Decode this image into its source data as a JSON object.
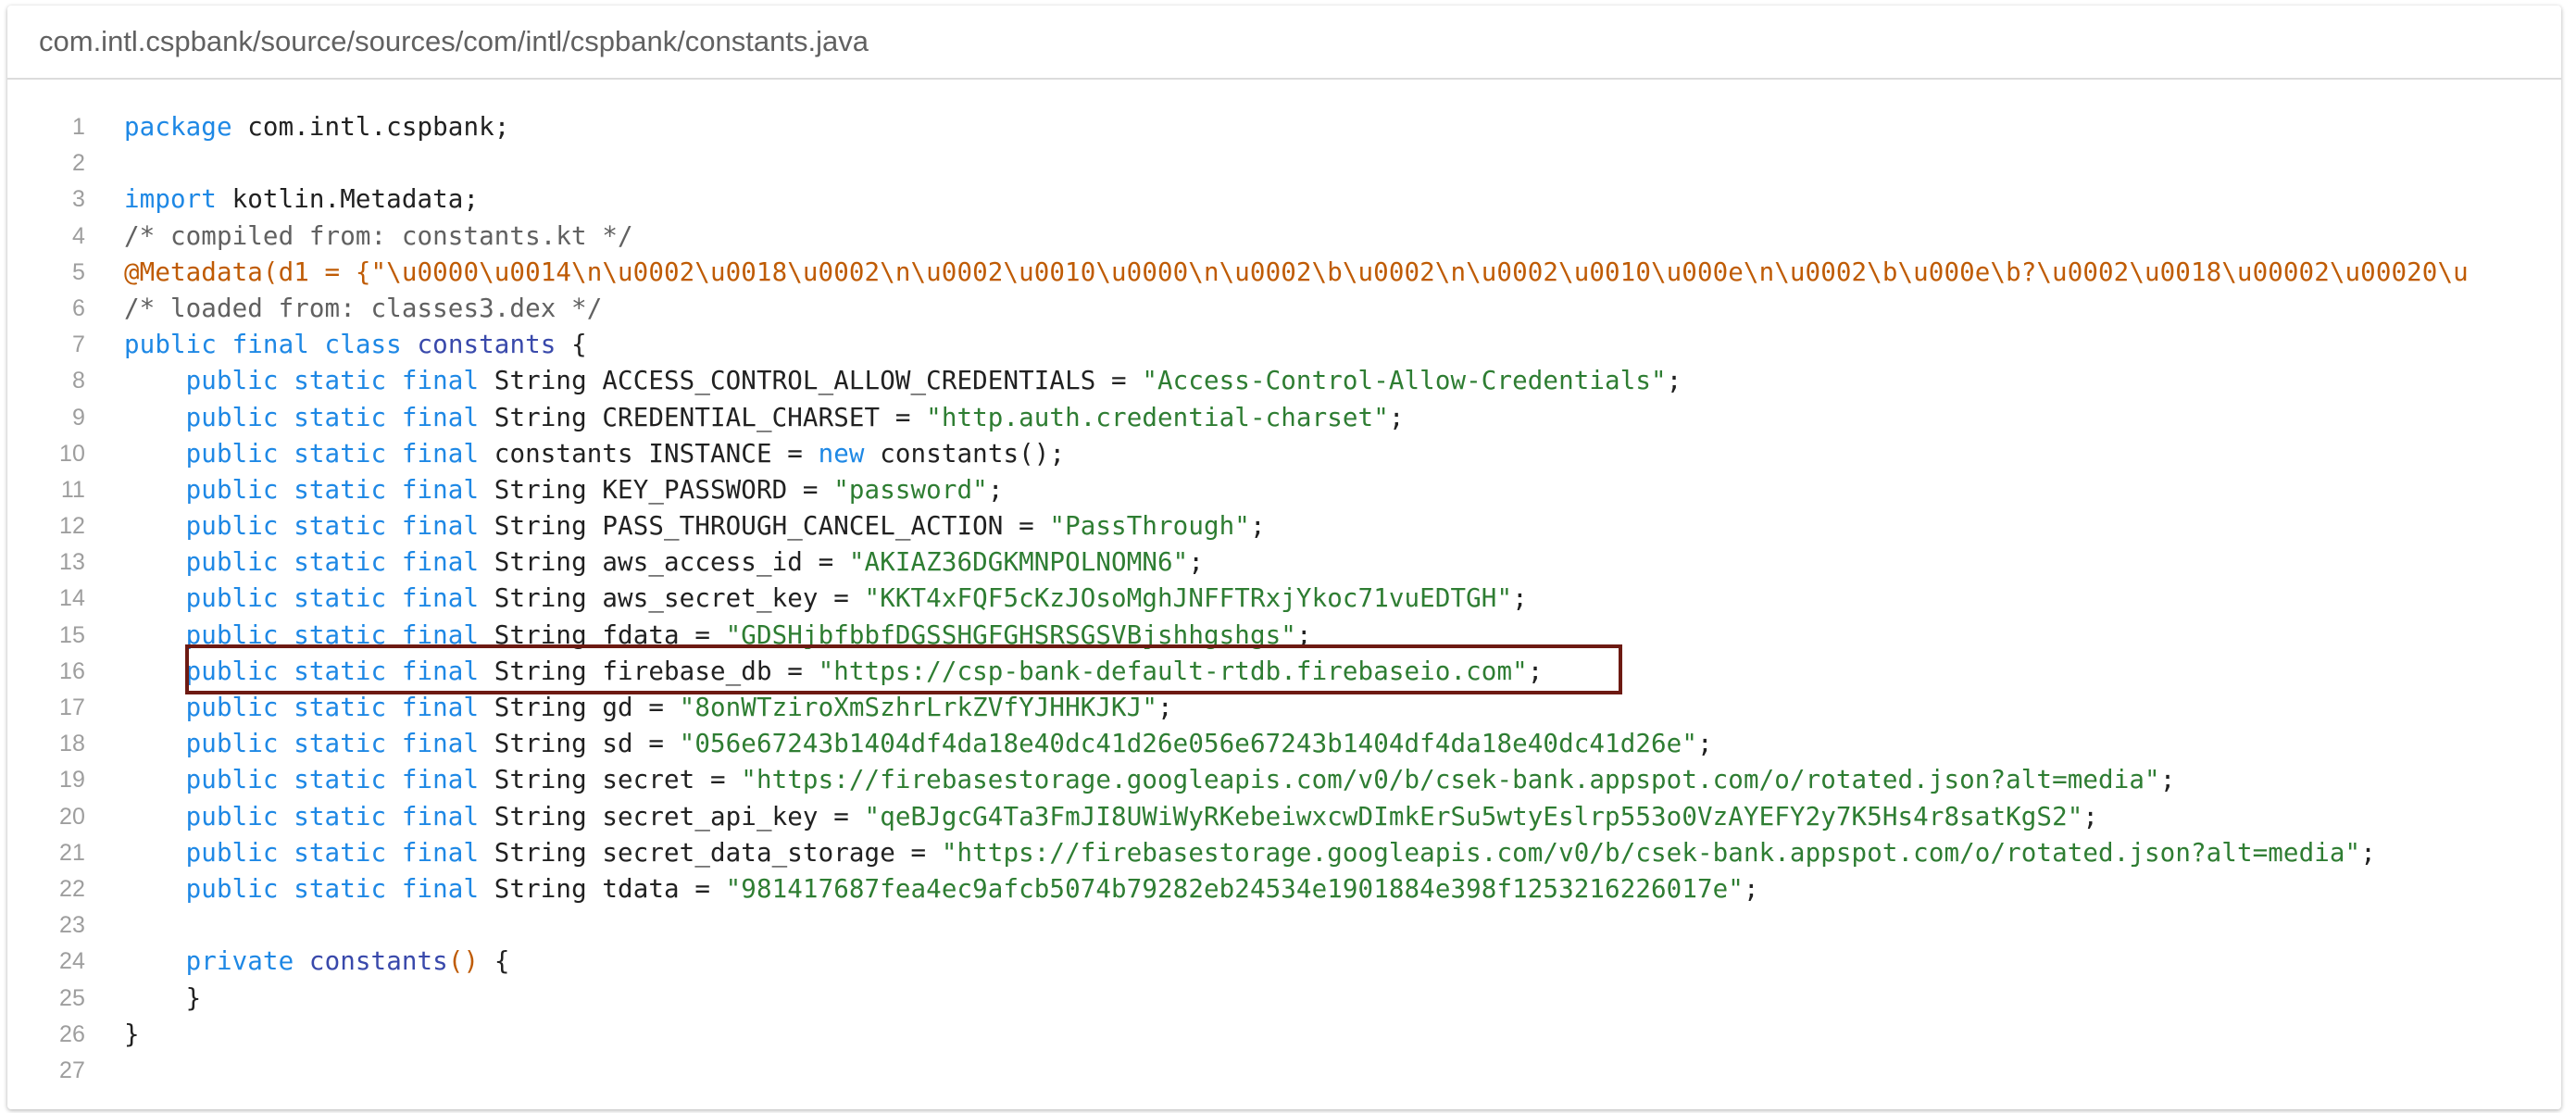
{
  "file_path": "com.intl.cspbank/source/sources/com/intl/cspbank/constants.java",
  "colors": {
    "keyword": "#1e88e5",
    "string": "#2e7d32",
    "comment": "#616161",
    "annotation": "#bf5b04",
    "highlight_border": "#6d1a12"
  },
  "highlighted_line": 16,
  "lines": [
    {
      "n": "1",
      "tokens": [
        [
          "kw",
          "package"
        ],
        [
          "tx",
          " com.intl.cspbank;"
        ]
      ]
    },
    {
      "n": "2",
      "tokens": []
    },
    {
      "n": "3",
      "tokens": [
        [
          "kw",
          "import"
        ],
        [
          "tx",
          " kotlin.Metadata;"
        ]
      ]
    },
    {
      "n": "4",
      "tokens": [
        [
          "cm",
          "/* compiled from: constants.kt */"
        ]
      ]
    },
    {
      "n": "5",
      "tokens": [
        [
          "an",
          "@Metadata(d1 = {\"\\u0000\\u0014\\n\\u0002\\u0018\\u0002\\n\\u0002\\u0010\\u0000\\n\\u0002\\b\\u0002\\n\\u0002\\u0010\\u000e\\n\\u0002\\b\\u000e\\b?\\u0002\\u0018\\u00002\\u00020\\u"
        ]
      ]
    },
    {
      "n": "6",
      "tokens": [
        [
          "cm",
          "/* loaded from: classes3.dex */"
        ]
      ]
    },
    {
      "n": "7",
      "tokens": [
        [
          "kw",
          "public final class"
        ],
        [
          "tx",
          " "
        ],
        [
          "fn",
          "constants"
        ],
        [
          "tx",
          " {"
        ]
      ]
    },
    {
      "n": "8",
      "tokens": [
        [
          "tx",
          "    "
        ],
        [
          "kw",
          "public static final"
        ],
        [
          "tx",
          " String ACCESS_CONTROL_ALLOW_CREDENTIALS = "
        ],
        [
          "st",
          "\"Access-Control-Allow-Credentials\""
        ],
        [
          "tx",
          ";"
        ]
      ]
    },
    {
      "n": "9",
      "tokens": [
        [
          "tx",
          "    "
        ],
        [
          "kw",
          "public static final"
        ],
        [
          "tx",
          " String CREDENTIAL_CHARSET = "
        ],
        [
          "st",
          "\"http.auth.credential-charset\""
        ],
        [
          "tx",
          ";"
        ]
      ]
    },
    {
      "n": "10",
      "tokens": [
        [
          "tx",
          "    "
        ],
        [
          "kw",
          "public static final"
        ],
        [
          "tx",
          " constants INSTANCE = "
        ],
        [
          "kw",
          "new"
        ],
        [
          "tx",
          " constants();"
        ]
      ]
    },
    {
      "n": "11",
      "tokens": [
        [
          "tx",
          "    "
        ],
        [
          "kw",
          "public static final"
        ],
        [
          "tx",
          " String KEY_PASSWORD = "
        ],
        [
          "st",
          "\"password\""
        ],
        [
          "tx",
          ";"
        ]
      ]
    },
    {
      "n": "12",
      "tokens": [
        [
          "tx",
          "    "
        ],
        [
          "kw",
          "public static final"
        ],
        [
          "tx",
          " String PASS_THROUGH_CANCEL_ACTION = "
        ],
        [
          "st",
          "\"PassThrough\""
        ],
        [
          "tx",
          ";"
        ]
      ]
    },
    {
      "n": "13",
      "tokens": [
        [
          "tx",
          "    "
        ],
        [
          "kw",
          "public static final"
        ],
        [
          "tx",
          " String aws_access_id = "
        ],
        [
          "st",
          "\"AKIAZ36DGKMNPOLNOMN6\""
        ],
        [
          "tx",
          ";"
        ]
      ]
    },
    {
      "n": "14",
      "tokens": [
        [
          "tx",
          "    "
        ],
        [
          "kw",
          "public static final"
        ],
        [
          "tx",
          " String aws_secret_key = "
        ],
        [
          "st",
          "\"KKT4xFQF5cKzJOsoMghJNFFTRxjYkoc71vuEDTGH\""
        ],
        [
          "tx",
          ";"
        ]
      ]
    },
    {
      "n": "15",
      "tokens": [
        [
          "tx",
          "    "
        ],
        [
          "kw",
          "public static final"
        ],
        [
          "tx",
          " String fdata = "
        ],
        [
          "st",
          "\"GDSHjbfbbfDGSSHGFGHSRSGSVBjshhgshgs\""
        ],
        [
          "tx",
          ";"
        ]
      ]
    },
    {
      "n": "16",
      "tokens": [
        [
          "tx",
          "    "
        ],
        [
          "kw",
          "public static final"
        ],
        [
          "tx",
          " String firebase_db = "
        ],
        [
          "st",
          "\"https://csp-bank-default-rtdb.firebaseio.com\""
        ],
        [
          "tx",
          ";"
        ]
      ]
    },
    {
      "n": "17",
      "tokens": [
        [
          "tx",
          "    "
        ],
        [
          "kw",
          "public static final"
        ],
        [
          "tx",
          " String gd = "
        ],
        [
          "st",
          "\"8onWTziroXmSzhrLrkZVfYJHHKJKJ\""
        ],
        [
          "tx",
          ";"
        ]
      ]
    },
    {
      "n": "18",
      "tokens": [
        [
          "tx",
          "    "
        ],
        [
          "kw",
          "public static final"
        ],
        [
          "tx",
          " String sd = "
        ],
        [
          "st",
          "\"056e67243b1404df4da18e40dc41d26e056e67243b1404df4da18e40dc41d26e\""
        ],
        [
          "tx",
          ";"
        ]
      ]
    },
    {
      "n": "19",
      "tokens": [
        [
          "tx",
          "    "
        ],
        [
          "kw",
          "public static final"
        ],
        [
          "tx",
          " String secret = "
        ],
        [
          "st",
          "\"https://firebasestorage.googleapis.com/v0/b/csek-bank.appspot.com/o/rotated.json?alt=media\""
        ],
        [
          "tx",
          ";"
        ]
      ]
    },
    {
      "n": "20",
      "tokens": [
        [
          "tx",
          "    "
        ],
        [
          "kw",
          "public static final"
        ],
        [
          "tx",
          " String secret_api_key = "
        ],
        [
          "st",
          "\"qeBJgcG4Ta3FmJI8UWiWyRKebeiwxcwDImkErSu5wtyEslrp553o0VzAYEFY2y7K5Hs4r8satKgS2\""
        ],
        [
          "tx",
          ";"
        ]
      ]
    },
    {
      "n": "21",
      "tokens": [
        [
          "tx",
          "    "
        ],
        [
          "kw",
          "public static final"
        ],
        [
          "tx",
          " String secret_data_storage = "
        ],
        [
          "st",
          "\"https://firebasestorage.googleapis.com/v0/b/csek-bank.appspot.com/o/rotated.json?alt=media\""
        ],
        [
          "tx",
          ";"
        ]
      ]
    },
    {
      "n": "22",
      "tokens": [
        [
          "tx",
          "    "
        ],
        [
          "kw",
          "public static final"
        ],
        [
          "tx",
          " String tdata = "
        ],
        [
          "st",
          "\"981417687fea4ec9afcb5074b79282eb24534e1901884e398f1253216226017e\""
        ],
        [
          "tx",
          ";"
        ]
      ]
    },
    {
      "n": "23",
      "tokens": []
    },
    {
      "n": "24",
      "tokens": [
        [
          "tx",
          "    "
        ],
        [
          "kw",
          "private"
        ],
        [
          "tx",
          " "
        ],
        [
          "fn",
          "constants"
        ],
        [
          "an",
          "()"
        ],
        [
          "tx",
          " {"
        ]
      ]
    },
    {
      "n": "25",
      "tokens": [
        [
          "tx",
          "    }"
        ]
      ]
    },
    {
      "n": "26",
      "tokens": [
        [
          "tx",
          "}"
        ]
      ]
    },
    {
      "n": "27",
      "tokens": []
    }
  ]
}
